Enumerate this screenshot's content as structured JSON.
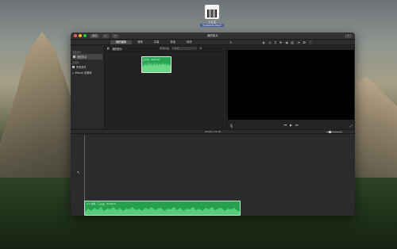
{
  "desktop": {
    "file_name_line1": "三公主",
    "file_name_line2": "Summer.mp3"
  },
  "window": {
    "title": "我的影片",
    "back_label": "项目",
    "traffic_lights": [
      "#ff5f57",
      "#febc2e",
      "#28c840"
    ]
  },
  "tabs": [
    {
      "label": "我的媒体",
      "active": true
    },
    {
      "label": "音频",
      "active": false
    },
    {
      "label": "字幕",
      "active": false
    },
    {
      "label": "背景",
      "active": false
    },
    {
      "label": "转场",
      "active": false
    }
  ],
  "sidebar": {
    "section1": "项目媒体",
    "item_project": "我的影片",
    "section2": "资源库",
    "item_all": "所有事件",
    "item_imovie": "iMovie 资源库"
  },
  "browser": {
    "title": "我的影片",
    "filter": "所有片段",
    "search_placeholder": "搜索",
    "clip_label": "三公主 - Summer"
  },
  "timeline": {
    "time": "00:00 / 01:16",
    "audio_label": "2.1 分钟 – 三公主 - Summer"
  },
  "colors": {
    "audio_green": "#27a04e",
    "window_bg": "#252525"
  }
}
